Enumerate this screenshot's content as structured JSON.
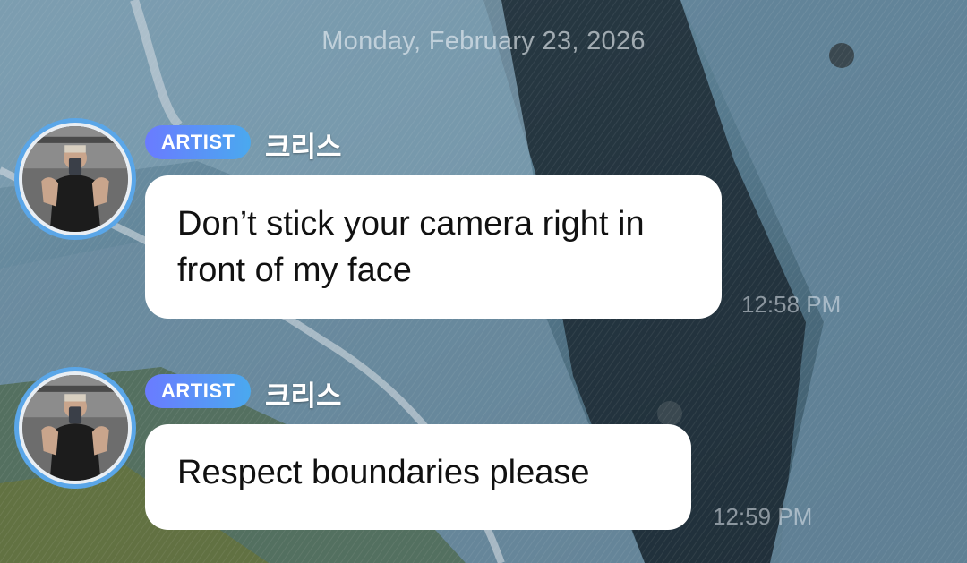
{
  "chat": {
    "date_divider": "Monday, February 23, 2026",
    "messages": [
      {
        "badge": "ARTIST",
        "sender": "크리스",
        "text": "Don’t stick your camera right in front of my face",
        "time": "12:58 PM"
      },
      {
        "badge": "ARTIST",
        "sender": "크리스",
        "text": "Respect boundaries please",
        "time": "12:59 PM"
      }
    ]
  },
  "colors": {
    "badge_gradient_start": "#6a7bff",
    "badge_gradient_end": "#4aa9ef",
    "avatar_ring": "#5aa6e8",
    "bubble": "#ffffff"
  },
  "icons": {
    "avatar": "profile-photo-mirror-selfie"
  }
}
